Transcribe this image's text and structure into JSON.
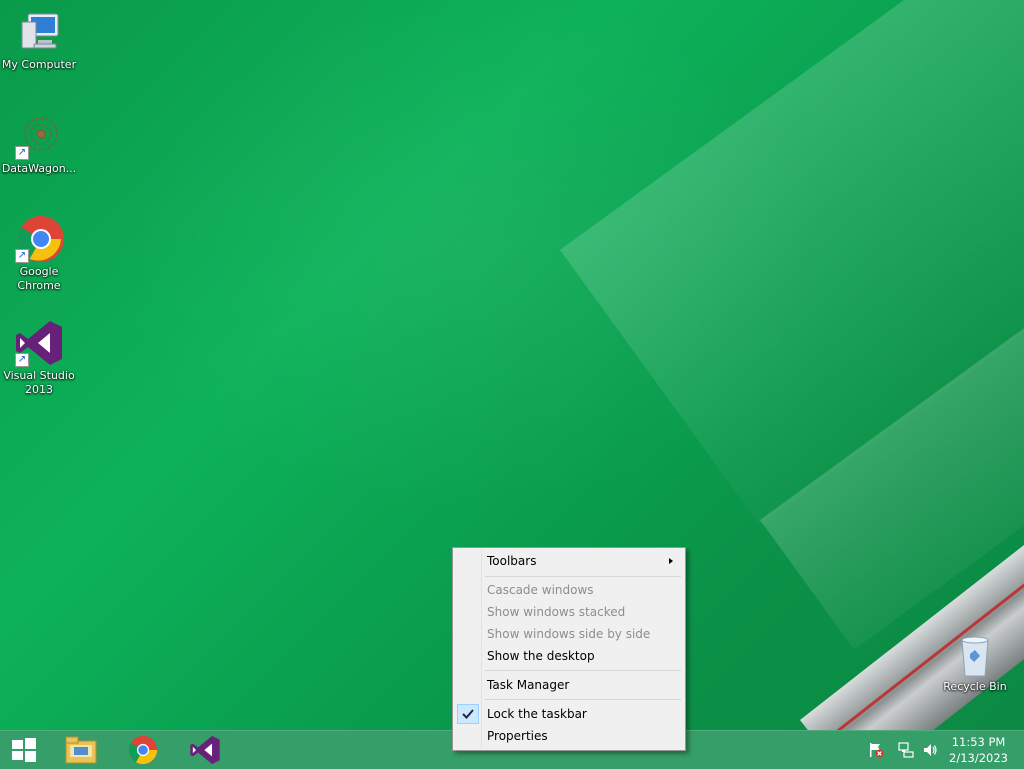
{
  "desktop": {
    "icons": [
      {
        "label": "My Computer",
        "icon": "computer-icon"
      },
      {
        "label": "DataWagon...",
        "icon": "datawagon-icon"
      },
      {
        "label": "Google Chrome",
        "icon": "chrome-icon"
      },
      {
        "label": "Visual Studio 2013",
        "icon": "visual-studio-icon"
      },
      {
        "label": "Recycle Bin",
        "icon": "recycle-bin-icon"
      }
    ]
  },
  "context_menu": {
    "items": [
      {
        "label": "Toolbars",
        "enabled": true,
        "submenu": true
      },
      {
        "label": "Cascade windows",
        "enabled": false
      },
      {
        "label": "Show windows stacked",
        "enabled": false
      },
      {
        "label": "Show windows side by side",
        "enabled": false
      },
      {
        "label": "Show the desktop",
        "enabled": true
      },
      {
        "label": "Task Manager",
        "enabled": true
      },
      {
        "label": "Lock the taskbar",
        "enabled": true,
        "checked": true
      },
      {
        "label": "Properties",
        "enabled": true
      }
    ]
  },
  "taskbar": {
    "pinned": [
      {
        "icon": "file-explorer-icon"
      },
      {
        "icon": "chrome-icon"
      },
      {
        "icon": "visual-studio-icon"
      }
    ],
    "tray_icons": [
      "action-center-flag-icon",
      "network-icon",
      "volume-icon"
    ],
    "clock": {
      "time": "11:53 PM",
      "date": "2/13/2023"
    }
  },
  "colors": {
    "desktop_green": "#0db25a",
    "taskbar": "#24965c",
    "menu_bg": "#f0f0f0",
    "disabled_text": "#8d8d8d",
    "vs_purple": "#68217a"
  }
}
